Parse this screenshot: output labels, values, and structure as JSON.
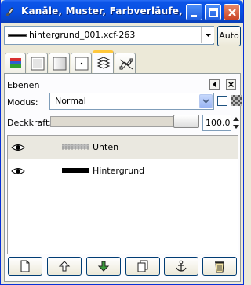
{
  "window": {
    "title": "Kanäle, Muster, Farbverläufe, ..."
  },
  "image_selector": {
    "value": "hintergrund_001.xcf-263",
    "auto_label": "Auto"
  },
  "tabs": [
    {
      "name": "channels",
      "icon": "channels-icon"
    },
    {
      "name": "patterns",
      "icon": "pattern-icon"
    },
    {
      "name": "gradients",
      "icon": "gradient-icon"
    },
    {
      "name": "brushes",
      "icon": "brush-dot-icon"
    },
    {
      "name": "layers",
      "icon": "layers-icon",
      "active": true
    },
    {
      "name": "paths",
      "icon": "paths-icon"
    }
  ],
  "layers_panel": {
    "title": "Ebenen",
    "mode_label": "Modus:",
    "mode_value": "Normal",
    "opacity_label": "Deckkraft:",
    "opacity_value": "100,0",
    "layers": [
      {
        "name": "Unten",
        "visible": true,
        "selected": true
      },
      {
        "name": "Hintergrund",
        "visible": true,
        "selected": false
      }
    ]
  },
  "buttons": [
    "new-layer",
    "raise-layer",
    "lower-layer",
    "duplicate-layer",
    "anchor-layer",
    "delete-layer"
  ],
  "colors": {
    "titlebar": "#0850e2",
    "panel_bg": "#ece9d8",
    "selection": "#eae8e0"
  }
}
